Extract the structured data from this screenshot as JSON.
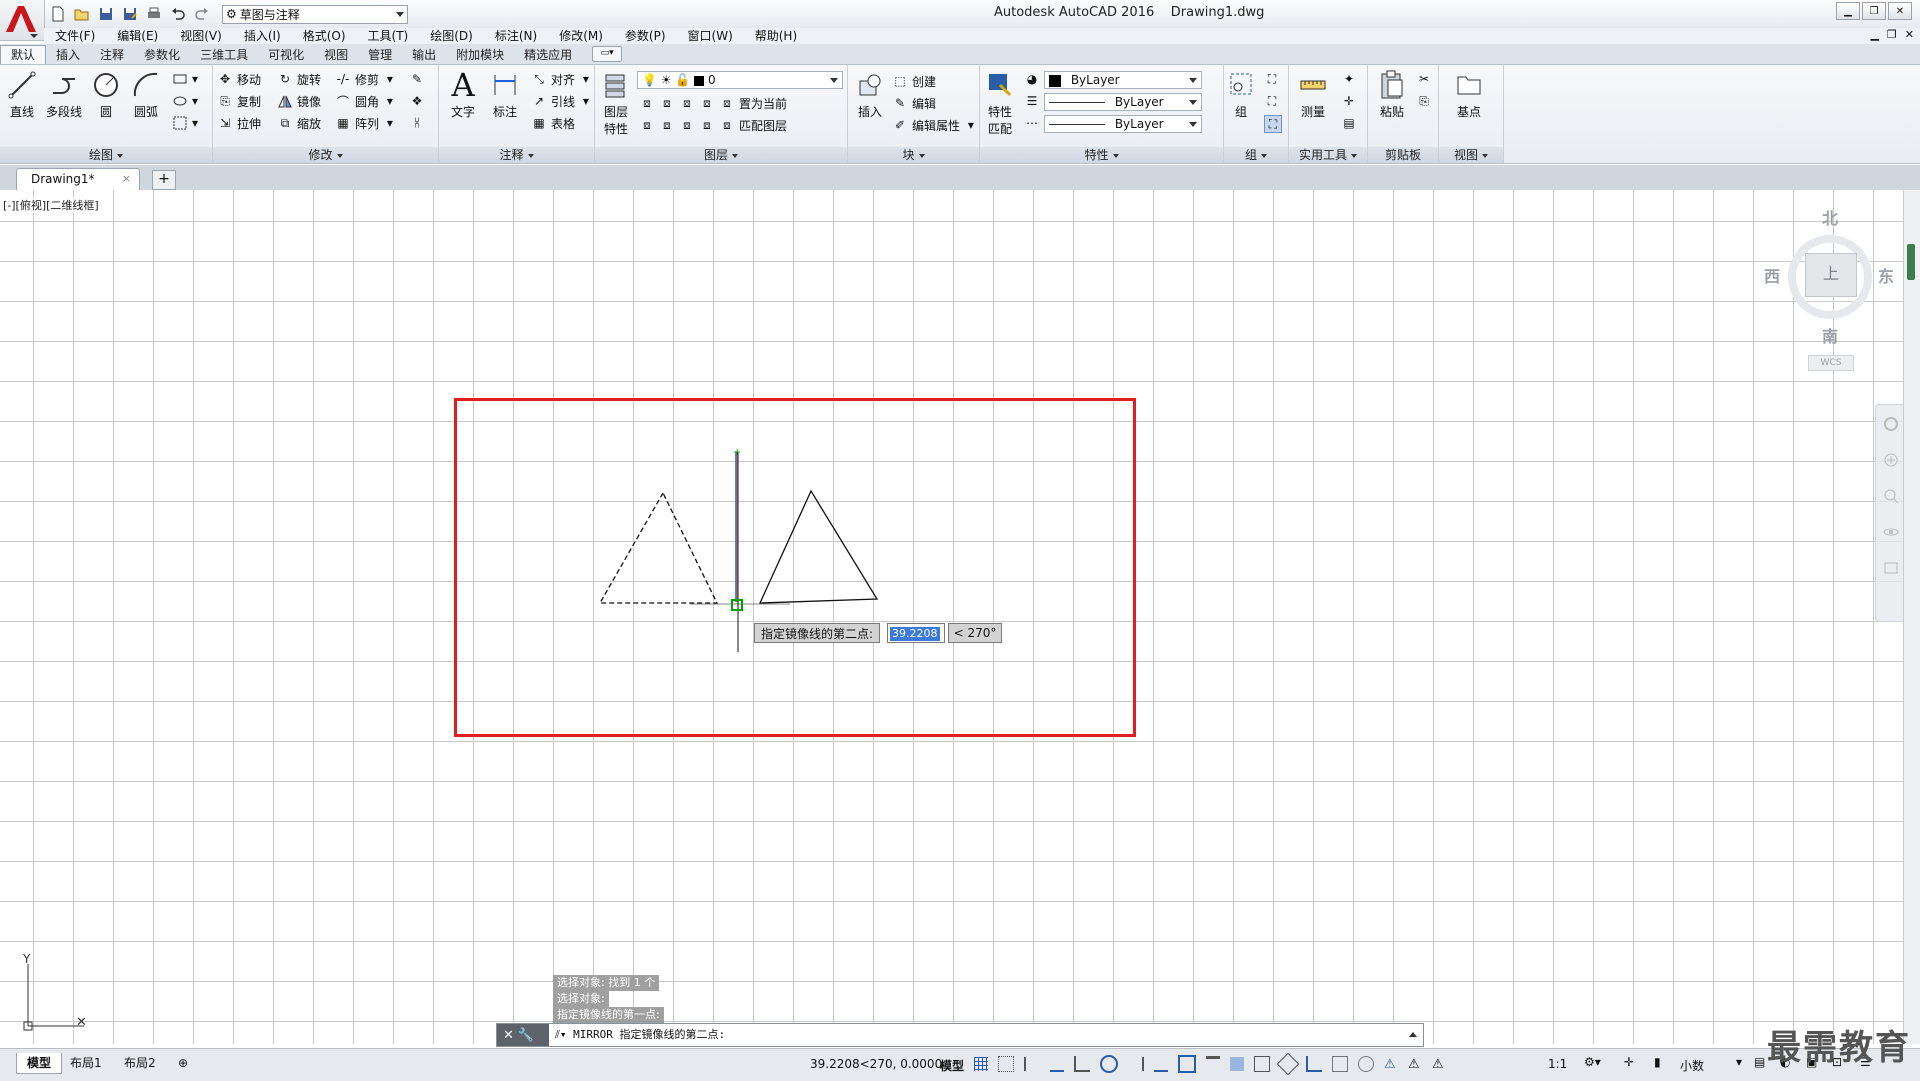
{
  "window": {
    "app_title": "Autodesk AutoCAD 2016",
    "drawing_title": "Drawing1.dwg",
    "workspace": "草图与注释"
  },
  "menu": [
    "文件(F)",
    "编辑(E)",
    "视图(V)",
    "插入(I)",
    "格式(O)",
    "工具(T)",
    "绘图(D)",
    "标注(N)",
    "修改(M)",
    "参数(P)",
    "窗口(W)",
    "帮助(H)"
  ],
  "ribbon_tabs": [
    "默认",
    "插入",
    "注释",
    "参数化",
    "三维工具",
    "可视化",
    "视图",
    "管理",
    "输出",
    "附加模块",
    "精选应用"
  ],
  "panels": {
    "draw": {
      "title": "绘图",
      "line": "直线",
      "polyline": "多段线",
      "circle": "圆",
      "arc": "圆弧"
    },
    "modify": {
      "title": "修改",
      "move": "移动",
      "rotate": "旋转",
      "trim": "修剪",
      "copy": "复制",
      "mirror": "镜像",
      "fillet": "圆角",
      "stretch": "拉伸",
      "scale": "缩放",
      "array": "阵列"
    },
    "annotation": {
      "title": "注释",
      "text": "文字",
      "dimension": "标注",
      "align": "对齐",
      "leader": "引线",
      "table": "表格"
    },
    "layers": {
      "title": "图层",
      "properties_line1": "图层",
      "properties_line2": "特性",
      "layer_value": "0",
      "set_current": "置为当前",
      "match_layer": "匹配图层"
    },
    "block": {
      "title": "块",
      "insert": "插入",
      "create": "创建",
      "edit": "编辑",
      "edit_attr": "编辑属性"
    },
    "properties": {
      "title": "特性",
      "match_line1": "特性",
      "match_line2": "匹配",
      "color": "ByLayer",
      "linetype": "ByLayer",
      "lineweight": "ByLayer"
    },
    "groups": {
      "title": "组",
      "group": "组"
    },
    "utilities": {
      "title": "实用工具",
      "measure": "测量"
    },
    "clipboard": {
      "title": "剪贴板",
      "paste": "粘贴"
    },
    "view": {
      "title": "视图",
      "base": "基点"
    }
  },
  "file_tab": {
    "name": "Drawing1*",
    "close": "×",
    "new": "+"
  },
  "viewport": {
    "label": "[-][俯视][二维线框]",
    "viewcube": {
      "north": "北",
      "south": "南",
      "east": "东",
      "west": "西",
      "face": "上",
      "wcs": "WCS"
    }
  },
  "dynamic_input": {
    "prompt": "指定镜像线的第二点:",
    "value": "39.2208",
    "angle": "< 270°"
  },
  "command_history": [
    "选择对象: 找到 1 个",
    "选择对象:",
    "指定镜像线的第一点:"
  ],
  "command_line": "MIRROR 指定镜像线的第二点:",
  "status": {
    "layout_tabs": [
      "模型",
      "布局1",
      "布局2"
    ],
    "coords": "39.2208<270, 0.0000",
    "model": "模型",
    "scale": "1:1",
    "units": "小数"
  },
  "watermark": "最需教育",
  "colors": {
    "highlight": "#e02020",
    "mirror_line": "#1f5fd8",
    "cursor": "#00a000",
    "app_red": "#c8161d"
  }
}
